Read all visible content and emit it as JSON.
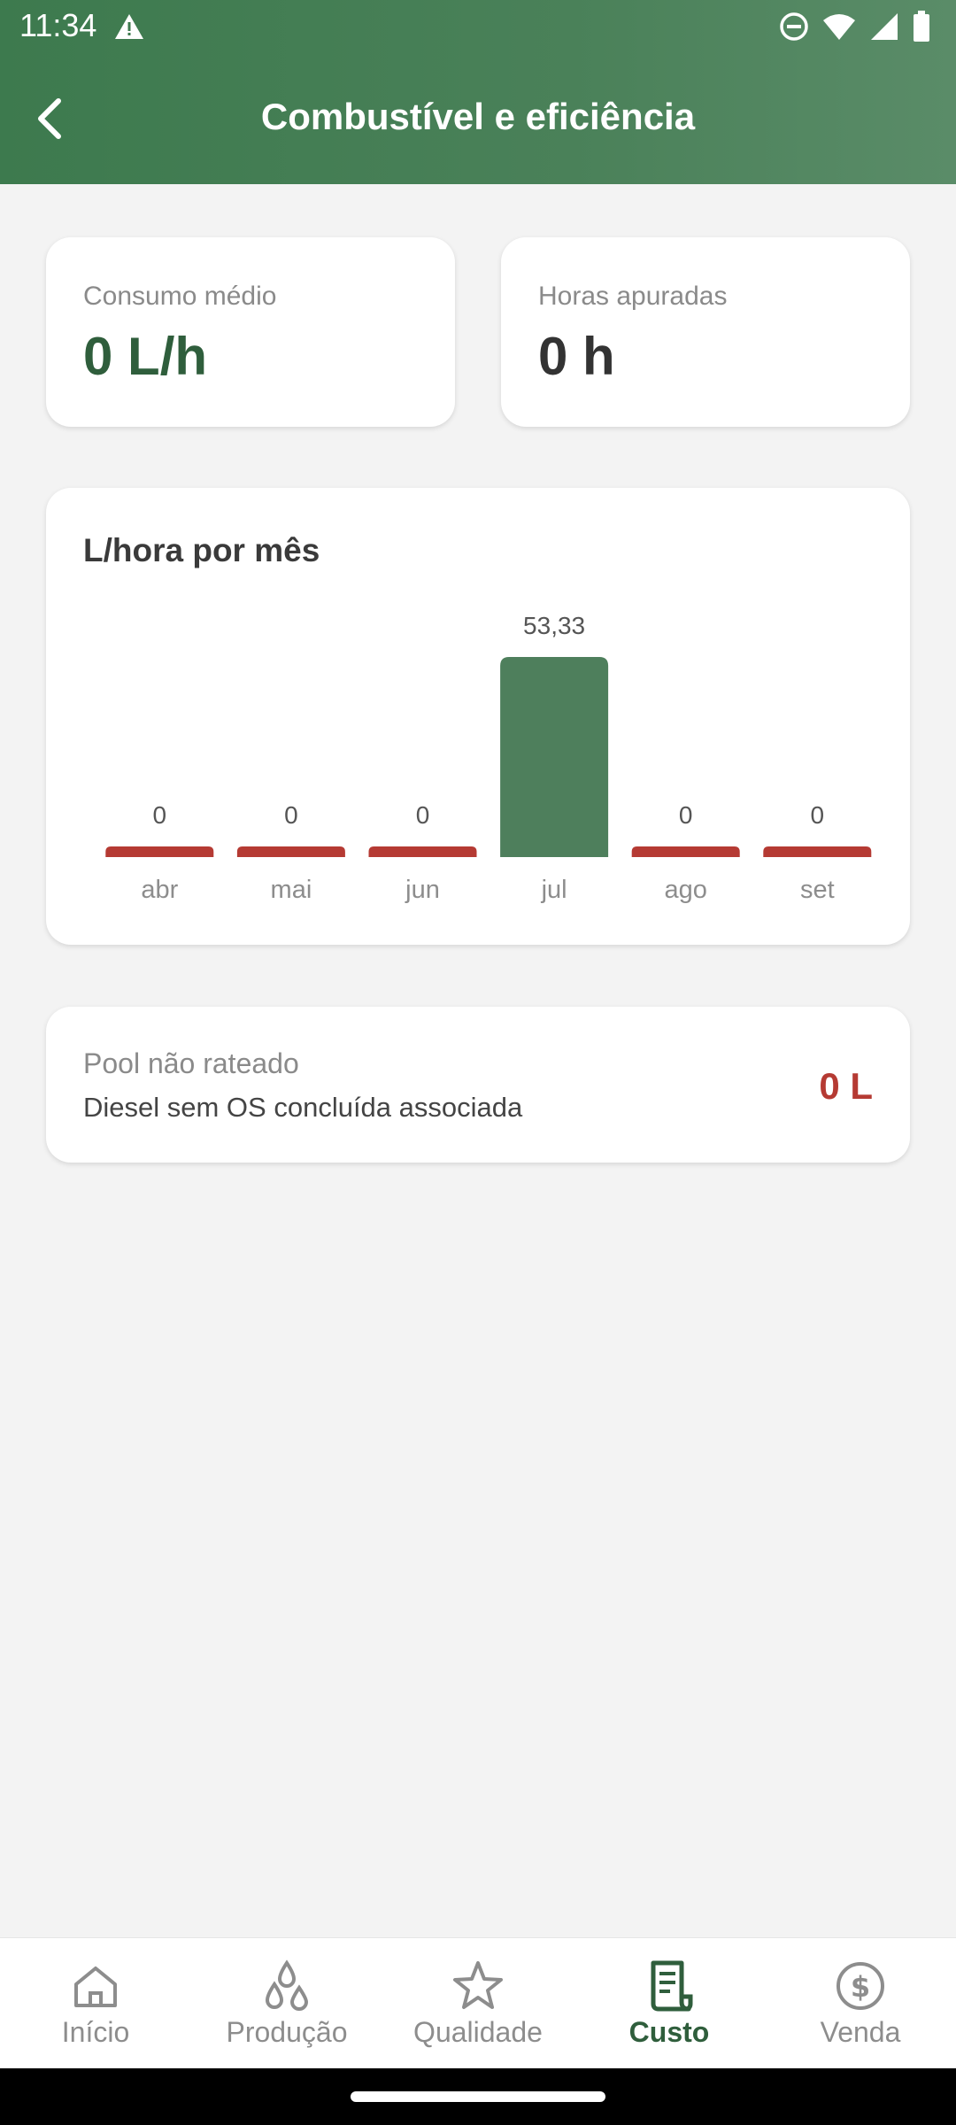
{
  "status_bar": {
    "time": "11:34"
  },
  "header": {
    "title": "Combustível e eficiência"
  },
  "stats": [
    {
      "label": "Consumo médio",
      "value": "0 L/h",
      "color": "#2f5e3c"
    },
    {
      "label": "Horas apuradas",
      "value": "0 h",
      "color": "#333333"
    }
  ],
  "chart_data": {
    "type": "bar",
    "title": "L/hora por mês",
    "categories": [
      "abr",
      "mai",
      "jun",
      "jul",
      "ago",
      "set"
    ],
    "values": [
      0,
      0,
      0,
      53.33
    ],
    "value_labels": [
      "0",
      "0",
      "0",
      "53,33",
      "0",
      "0"
    ],
    "ylim": [
      0,
      53.33
    ],
    "colors": {
      "positive": "#4e7f5c",
      "zero": "#b53a33"
    }
  },
  "pool": {
    "label": "Pool não rateado",
    "description": "Diesel sem OS concluída associada",
    "value": "0 L"
  },
  "nav": {
    "items": [
      {
        "label": "Início",
        "icon": "home-icon",
        "active": false
      },
      {
        "label": "Produção",
        "icon": "drops-icon",
        "active": false
      },
      {
        "label": "Qualidade",
        "icon": "star-icon",
        "active": false
      },
      {
        "label": "Custo",
        "icon": "receipt-icon",
        "active": true
      },
      {
        "label": "Venda",
        "icon": "dollar-coin-icon",
        "active": false
      }
    ]
  }
}
